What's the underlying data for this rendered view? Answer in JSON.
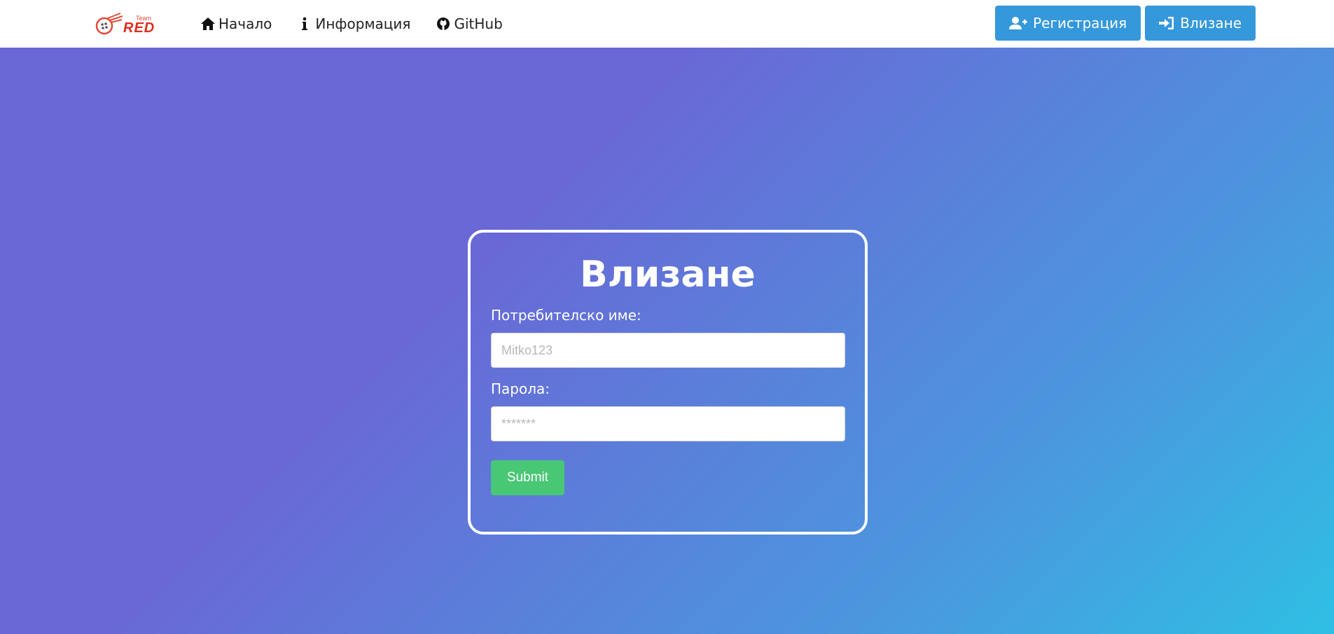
{
  "nav": {
    "logo": {
      "team": "Team",
      "name": "RED"
    },
    "links": [
      {
        "label": "Начало",
        "icon": "home-icon"
      },
      {
        "label": "Информация",
        "icon": "info-icon"
      },
      {
        "label": "GitHub",
        "icon": "github-icon"
      }
    ],
    "register_label": "Регистрация",
    "login_label": "Влизане"
  },
  "login_form": {
    "title": "Влизане",
    "username_label": "Потребителско име:",
    "username_placeholder": "Mitko123",
    "password_label": "Парола:",
    "password_placeholder": "*******",
    "submit_label": "Submit"
  },
  "colors": {
    "accent_button": "#3498db",
    "submit_button": "#48c774",
    "gradient_start": "#6a67d6",
    "gradient_end": "#2fbfe4"
  }
}
